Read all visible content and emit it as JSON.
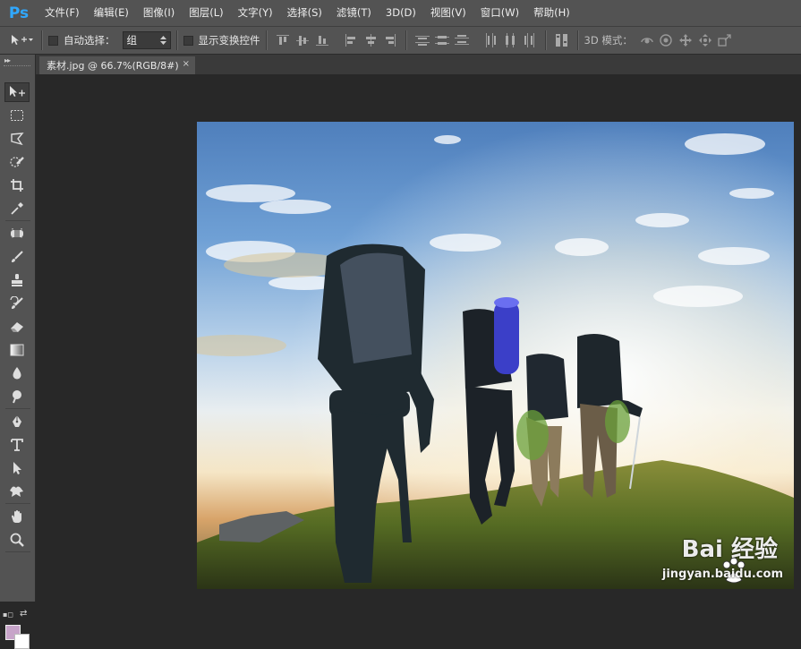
{
  "app": {
    "logo": "Ps"
  },
  "menu": [
    {
      "label": "文件(F)"
    },
    {
      "label": "编辑(E)"
    },
    {
      "label": "图像(I)"
    },
    {
      "label": "图层(L)"
    },
    {
      "label": "文字(Y)"
    },
    {
      "label": "选择(S)"
    },
    {
      "label": "滤镜(T)"
    },
    {
      "label": "3D(D)"
    },
    {
      "label": "视图(V)"
    },
    {
      "label": "窗口(W)"
    },
    {
      "label": "帮助(H)"
    }
  ],
  "options": {
    "auto_select_label": "自动选择：",
    "auto_select_value": "组",
    "show_transform_label": "显示变换控件",
    "mode_3d_label": "3D 模式："
  },
  "document": {
    "tab_title": "素材.jpg @ 66.7%(RGB/8#)",
    "close_glyph": "×"
  },
  "colors": {
    "foreground": "#c7a4c9",
    "background": "#ffffff",
    "ui_dark": "#282828",
    "ui_panel": "#535353",
    "ps_blue": "#30a8ff"
  },
  "watermark": {
    "logo": "Bai  经验",
    "url": "jingyan.baidu.com"
  },
  "tools": [
    "move-tool",
    "marquee-tool",
    "lasso-tool",
    "quick-selection-tool",
    "crop-tool",
    "eyedropper-tool",
    "healing-brush-tool",
    "brush-tool",
    "clone-stamp-tool",
    "history-brush-tool",
    "eraser-tool",
    "gradient-tool",
    "blur-tool",
    "dodge-tool",
    "pen-tool",
    "type-tool",
    "path-selection-tool",
    "custom-shape-tool",
    "hand-tool",
    "zoom-tool"
  ]
}
